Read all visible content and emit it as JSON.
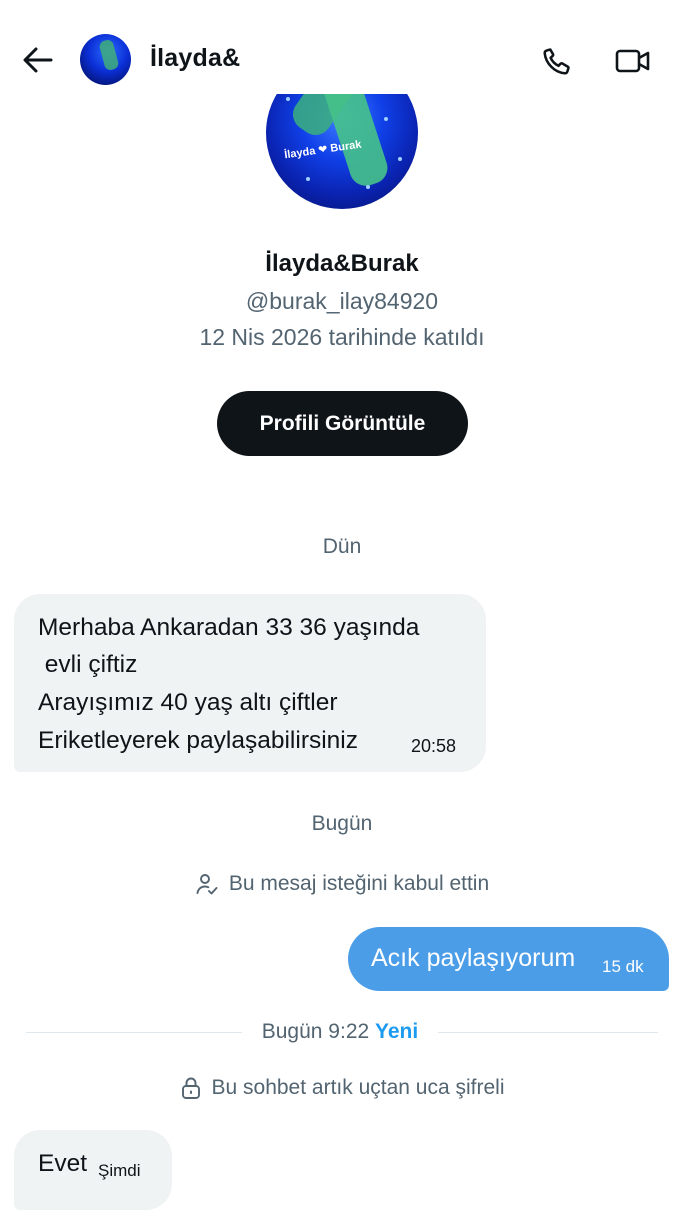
{
  "header": {
    "title": "İlayda&Burak"
  },
  "profile": {
    "name": "İlayda&Burak",
    "handle": "@burak_ilay84920",
    "joined": "12 Nis 2026 tarihinde katıldı",
    "avatar_caption": "İlayda ❤ Burak",
    "view_button": "Profili Görüntüle"
  },
  "conversation": {
    "date_yesterday": "Dün",
    "incoming_message": {
      "lines": [
        "Merhaba Ankaradan 33 36 yaşında",
        " evli çiftiz",
        "Arayışımız 40 yaş altı çiftler",
        "Eriketleyerek paylaşabilirsiniz"
      ],
      "time": "20:58"
    },
    "date_today": "Bugün",
    "request_accepted": "Bu mesaj isteğini kabul ettin",
    "outgoing_message": {
      "text": "Acık paylaşıyorum",
      "time": "15 dk"
    },
    "new_divider": {
      "label": "Bugün 9:22",
      "new_label": "Yeni"
    },
    "encryption_notice": "Bu sohbet artık uçtan uca şifreli",
    "last_message": {
      "text": "Evet",
      "time": "Şimdi"
    }
  },
  "colors": {
    "accent": "#1d9bf0",
    "outgoing_bubble": "#4c9de8",
    "incoming_bubble": "#eff3f4",
    "secondary_text": "#536471",
    "primary_text": "#0f1419"
  },
  "icons": {
    "back": "arrow-left-icon",
    "call": "phone-icon",
    "video": "video-camera-icon",
    "request": "person-check-icon",
    "lock": "lock-icon"
  }
}
